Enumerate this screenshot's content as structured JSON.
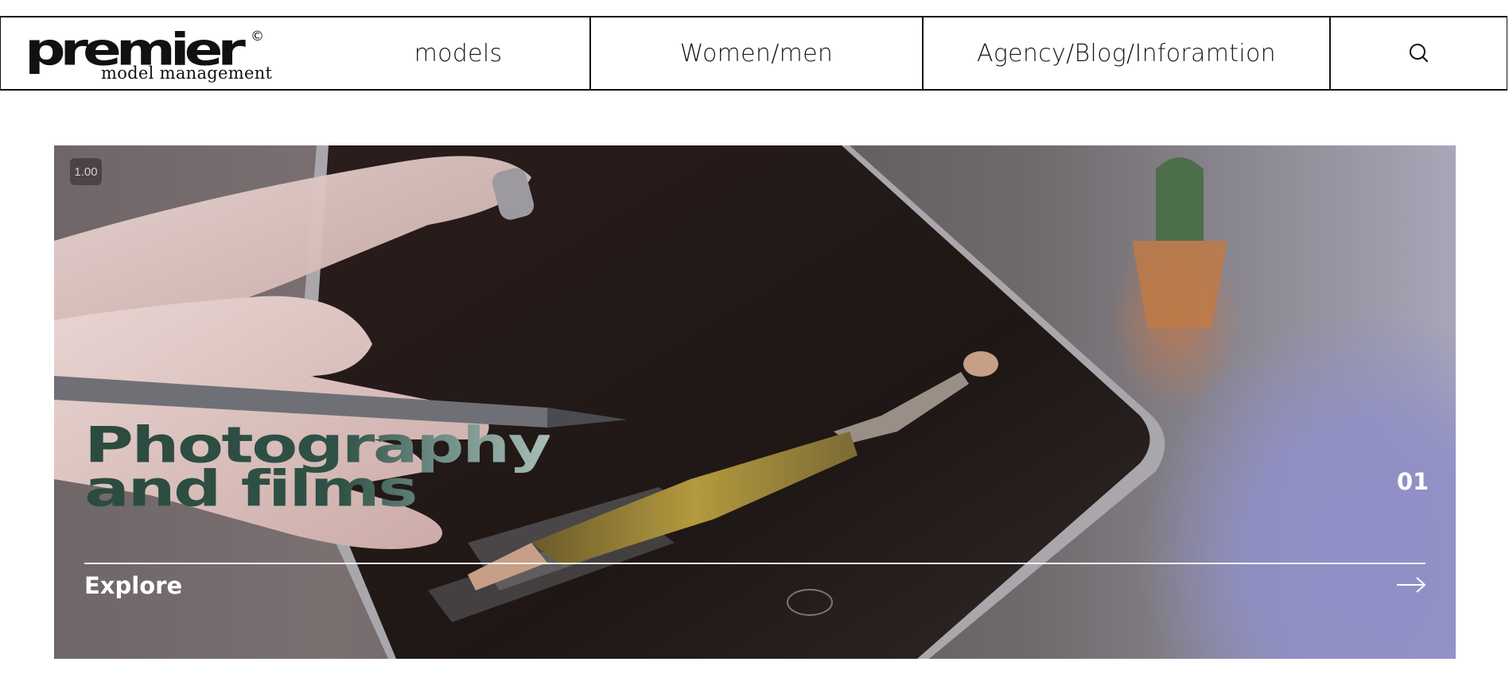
{
  "brand": {
    "logo_word": "premier",
    "logo_sub": "model management",
    "logo_mark": "©"
  },
  "nav": {
    "items": [
      {
        "label": "models"
      },
      {
        "label": "Women/men"
      },
      {
        "label": "Agency/Blog/Inforamtion"
      }
    ],
    "search_icon": "search-icon"
  },
  "hero": {
    "speed": "1.00",
    "title_line1": "Photography",
    "title_line2": "and films",
    "slide_number": "01",
    "cta_label": "Explore",
    "cta_icon": "arrow-right-icon",
    "title_color": "#2f5146"
  }
}
